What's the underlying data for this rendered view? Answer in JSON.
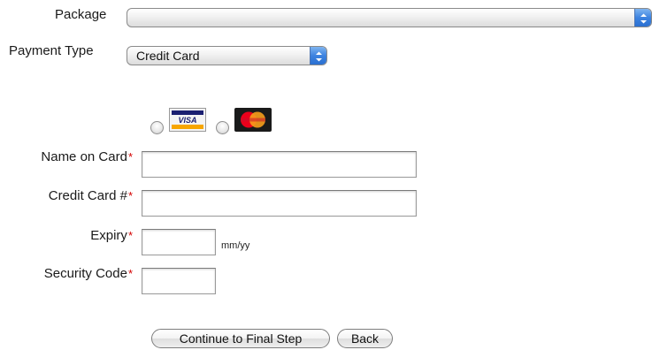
{
  "form": {
    "package": {
      "label": "Package",
      "value": ""
    },
    "payment_type": {
      "label": "Payment Type",
      "value": "Credit Card"
    },
    "card_types": [
      {
        "name": "VISA",
        "brand_color": "#1a1f71",
        "accent": "#f7a600"
      },
      {
        "name": "MasterCard",
        "brand_color": "#eb001b",
        "accent": "#f79e1b"
      }
    ],
    "name_on_card": {
      "label": "Name on Card",
      "value": ""
    },
    "card_number": {
      "label": "Credit Card #",
      "value": ""
    },
    "expiry": {
      "label": "Expiry",
      "value": "",
      "hint": "mm/yy"
    },
    "security_code": {
      "label": "Security Code",
      "value": ""
    },
    "required_marker": "*"
  },
  "actions": {
    "continue_label": "Continue to Final Step",
    "back_label": "Back"
  },
  "colors": {
    "required": "#d40000",
    "select_arrow": "#3d83e0"
  },
  "icons": {
    "select_arrows": "up-down-chevrons-icon"
  }
}
